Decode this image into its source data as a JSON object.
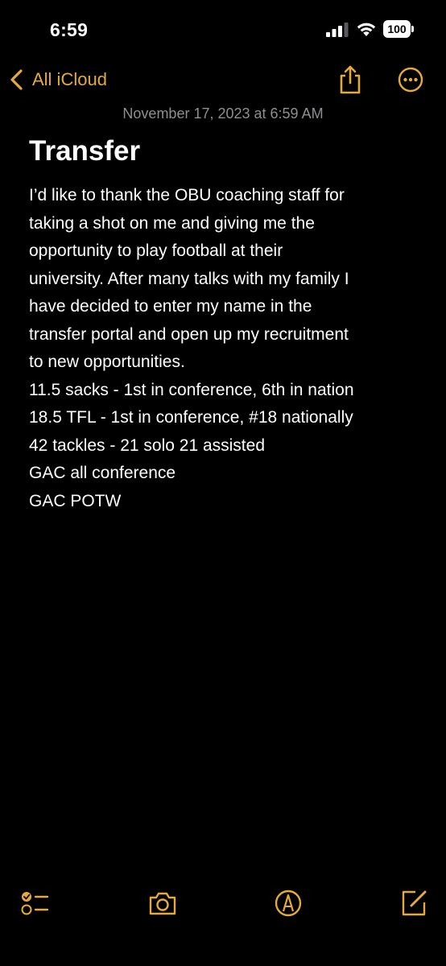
{
  "status_bar": {
    "time": "6:59",
    "battery": "100"
  },
  "nav": {
    "back_label": "All iCloud",
    "icons": [
      "chevron-left-icon",
      "share-icon",
      "more-icon"
    ]
  },
  "note": {
    "date": "November 17, 2023 at 6:59 AM",
    "title": "Transfer",
    "body_lines": [
      "I’d like to thank the OBU coaching staff for",
      "taking a shot on me and giving me the",
      "opportunity to play football at their",
      "university. After many talks with my family I",
      "have decided to enter my name in the",
      "transfer portal and open up my recruitment",
      "to new opportunities.",
      "11.5 sacks - 1st in conference, 6th in nation",
      "18.5 TFL - 1st in conference, #18 nationally",
      "42 tackles - 21 solo 21 assisted",
      "GAC all conference",
      "GAC POTW"
    ]
  },
  "toolbar": {
    "icons": [
      "checklist-icon",
      "camera-icon",
      "markup-icon",
      "compose-icon"
    ]
  },
  "colors": {
    "accent": "#e5aa3a",
    "background": "#000000",
    "text": "#ffffff",
    "secondary_text": "#8e8e93"
  }
}
